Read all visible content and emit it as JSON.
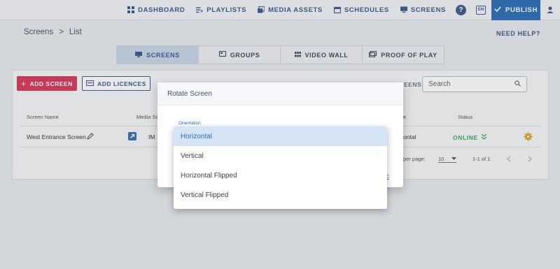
{
  "nav": {
    "items": [
      {
        "label": "DASHBOARD",
        "icon": "dashboard-icon"
      },
      {
        "label": "PLAYLISTS",
        "icon": "playlist-icon"
      },
      {
        "label": "MEDIA ASSETS",
        "icon": "media-icon"
      },
      {
        "label": "SCHEDULES",
        "icon": "calendar-icon"
      },
      {
        "label": "SCREENS",
        "icon": "monitor-icon"
      }
    ],
    "help_glyph": "?",
    "lang": "EN",
    "publish": "PUBLISH"
  },
  "breadcrumb": {
    "root": "Screens",
    "sep": ">",
    "current": "List"
  },
  "need_help": "NEED HELP?",
  "tabs": [
    {
      "label": "SCREENS",
      "active": true
    },
    {
      "label": "GROUPS",
      "active": false
    },
    {
      "label": "VIDEO WALL",
      "active": false
    },
    {
      "label": "PROOF OF PLAY",
      "active": false
    }
  ],
  "toolbar": {
    "add_screen": "ADD SCREEN",
    "add_licences": "ADD LICENCES",
    "screens_partial": "EENS",
    "search_placeholder": "Search"
  },
  "table": {
    "headers": {
      "name": "Screen Name",
      "media": "Media So",
      "orientation_partial": "e",
      "status": "Status"
    },
    "row": {
      "name": "West Entrance Screen",
      "media_partial": "IM",
      "orientation_partial": "ontal",
      "status": "ONLINE"
    },
    "pager": {
      "rows_label": "per page:",
      "rows_value": "10",
      "range": "1-1 of 1"
    }
  },
  "dialog": {
    "title": "Rotate Screen",
    "field_label": "Orientation",
    "action_partial": "E",
    "options": [
      "Horizontal",
      "Vertical",
      "Horizontal Flipped",
      "Vertical Flipped"
    ],
    "selected": "Horizontal"
  },
  "colors": {
    "accent": "#2f6fb8",
    "danger": "#d93a58",
    "online": "#3aa85a",
    "gear": "#e0a21a"
  }
}
